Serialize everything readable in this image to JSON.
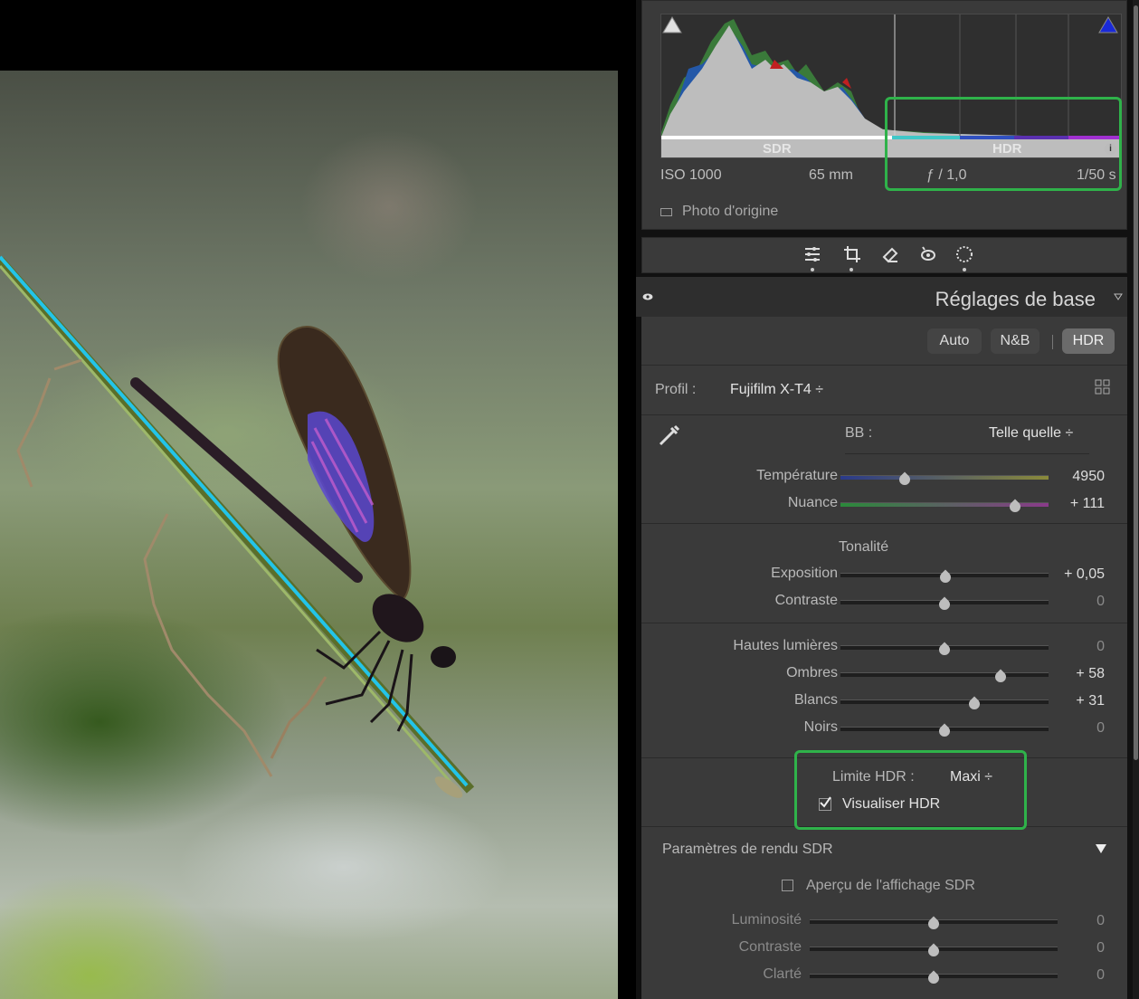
{
  "histogram": {
    "sdr_label": "SDR",
    "hdr_label": "HDR",
    "info_icon": "info-icon",
    "exif": {
      "iso": "ISO 1000",
      "focal": "65 mm",
      "aperture": "ƒ / 1,0",
      "shutter": "1/50 s"
    },
    "original_photo": "Photo d'origine"
  },
  "toolbar": {
    "icons": [
      "sliders-icon",
      "crop-icon",
      "eraser-icon",
      "red-eye-icon",
      "mask-icon"
    ]
  },
  "basic": {
    "title": "Réglages de base",
    "buttons": {
      "auto": "Auto",
      "bw": "N&B",
      "hdr": "HDR"
    },
    "profile_label": "Profil :",
    "profile_value": "Fujifilm X-T4 ÷",
    "wb_label": "BB :",
    "wb_value": "Telle quelle ÷",
    "temperature": {
      "label": "Température",
      "value": "4950",
      "position": 0.31
    },
    "tint": {
      "label": "Nuance",
      "value": "+ 111",
      "position": 0.84
    },
    "tone_header": "Tonalité",
    "exposure": {
      "label": "Exposition",
      "value": "+ 0,05",
      "position": 0.505
    },
    "contrast": {
      "label": "Contraste",
      "value": "0",
      "position": 0.5
    },
    "highlights": {
      "label": "Hautes lumières",
      "value": "0",
      "position": 0.5
    },
    "shadows": {
      "label": "Ombres",
      "value": "+ 58",
      "position": 0.77
    },
    "whites": {
      "label": "Blancs",
      "value": "+ 31",
      "position": 0.645
    },
    "blacks": {
      "label": "Noirs",
      "value": "0",
      "position": 0.5
    },
    "hdr_limit_label": "Limite HDR :",
    "hdr_limit_value": "Maxi ÷",
    "visualize_hdr": "Visualiser HDR",
    "sdr_settings": "Paramètres de rendu SDR",
    "sdr_preview": "Aperçu de l'affichage SDR",
    "brightness": {
      "label": "Luminosité",
      "value": "0",
      "position": 0.5
    },
    "sdr_contrast": {
      "label": "Contraste",
      "value": "0",
      "position": 0.5
    },
    "clarity": {
      "label": "Clarté",
      "value": "0",
      "position": 0.5
    }
  },
  "colors": {
    "highlight_box": "#2fb24a",
    "panel_bg": "#3a3a3a"
  }
}
